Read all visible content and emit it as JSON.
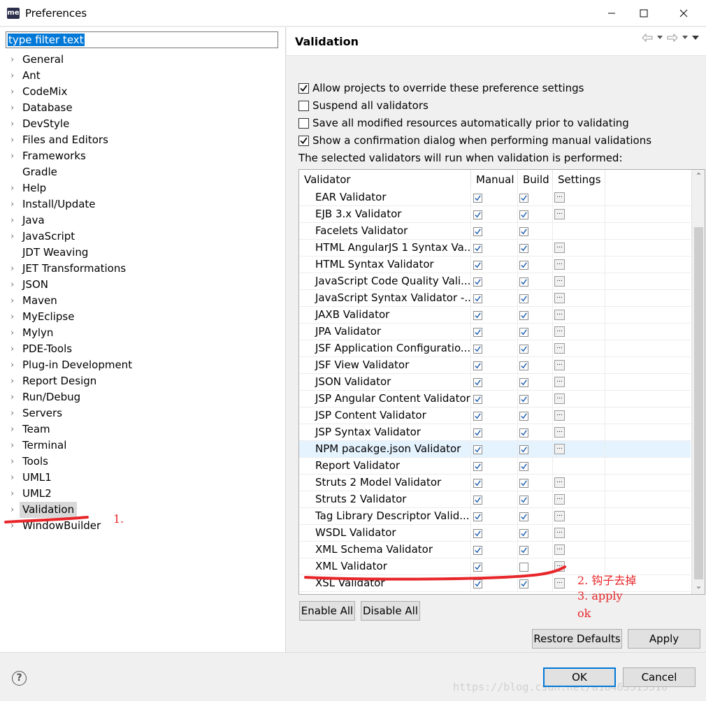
{
  "window": {
    "title": "Preferences",
    "icon_text": "me"
  },
  "filter": {
    "value": "type filter text"
  },
  "tree": [
    {
      "label": "General",
      "expandable": true
    },
    {
      "label": "Ant",
      "expandable": true
    },
    {
      "label": "CodeMix",
      "expandable": true
    },
    {
      "label": "Database",
      "expandable": true
    },
    {
      "label": "DevStyle",
      "expandable": true
    },
    {
      "label": "Files and Editors",
      "expandable": true
    },
    {
      "label": "Frameworks",
      "expandable": true
    },
    {
      "label": "Gradle",
      "expandable": false
    },
    {
      "label": "Help",
      "expandable": true
    },
    {
      "label": "Install/Update",
      "expandable": true
    },
    {
      "label": "Java",
      "expandable": true
    },
    {
      "label": "JavaScript",
      "expandable": true
    },
    {
      "label": "JDT Weaving",
      "expandable": false
    },
    {
      "label": "JET Transformations",
      "expandable": true
    },
    {
      "label": "JSON",
      "expandable": true
    },
    {
      "label": "Maven",
      "expandable": true
    },
    {
      "label": "MyEclipse",
      "expandable": true
    },
    {
      "label": "Mylyn",
      "expandable": true
    },
    {
      "label": "PDE-Tools",
      "expandable": true
    },
    {
      "label": "Plug-in Development",
      "expandable": true
    },
    {
      "label": "Report Design",
      "expandable": true
    },
    {
      "label": "Run/Debug",
      "expandable": true
    },
    {
      "label": "Servers",
      "expandable": true
    },
    {
      "label": "Team",
      "expandable": true
    },
    {
      "label": "Terminal",
      "expandable": true
    },
    {
      "label": "Tools",
      "expandable": true
    },
    {
      "label": "UML1",
      "expandable": true
    },
    {
      "label": "UML2",
      "expandable": true
    },
    {
      "label": "Validation",
      "expandable": true,
      "selected": true
    },
    {
      "label": "WindowBuilder",
      "expandable": true
    }
  ],
  "page": {
    "title": "Validation",
    "options": [
      {
        "label": "Allow projects to override these preference settings",
        "checked": true
      },
      {
        "label": "Suspend all validators",
        "checked": false
      },
      {
        "label": "Save all modified resources automatically prior to validating",
        "checked": false
      },
      {
        "label": "Show a confirmation dialog when performing manual validations",
        "checked": true
      }
    ],
    "info": "The selected validators will run when validation is performed:"
  },
  "table": {
    "headers": [
      "Validator",
      "Manual",
      "Build",
      "Settings"
    ],
    "settings_button_label": "...",
    "rows": [
      {
        "name": "EAR Validator",
        "manual": true,
        "build": true,
        "settings": true
      },
      {
        "name": "EJB 3.x Validator",
        "manual": true,
        "build": true,
        "settings": true
      },
      {
        "name": "Facelets Validator",
        "manual": true,
        "build": true,
        "settings": false
      },
      {
        "name": "HTML AngularJS 1 Syntax Va...",
        "manual": true,
        "build": true,
        "settings": true
      },
      {
        "name": "HTML Syntax Validator",
        "manual": true,
        "build": true,
        "settings": true
      },
      {
        "name": "JavaScript Code Quality Vali...",
        "manual": true,
        "build": true,
        "settings": true
      },
      {
        "name": "JavaScript Syntax Validator -...",
        "manual": true,
        "build": true,
        "settings": true
      },
      {
        "name": "JAXB Validator",
        "manual": true,
        "build": true,
        "settings": true
      },
      {
        "name": "JPA Validator",
        "manual": true,
        "build": true,
        "settings": true
      },
      {
        "name": "JSF Application Configuratio...",
        "manual": true,
        "build": true,
        "settings": true
      },
      {
        "name": "JSF View Validator",
        "manual": true,
        "build": true,
        "settings": true
      },
      {
        "name": "JSON Validator",
        "manual": true,
        "build": true,
        "settings": true
      },
      {
        "name": "JSP Angular Content Validator",
        "manual": true,
        "build": true,
        "settings": true
      },
      {
        "name": "JSP Content Validator",
        "manual": true,
        "build": true,
        "settings": true
      },
      {
        "name": "JSP Syntax Validator",
        "manual": true,
        "build": true,
        "settings": true
      },
      {
        "name": "NPM pacakge.json Validator",
        "manual": true,
        "build": true,
        "settings": true,
        "highlighted": true
      },
      {
        "name": "Report Validator",
        "manual": true,
        "build": true,
        "settings": false
      },
      {
        "name": "Struts 2 Model Validator",
        "manual": true,
        "build": true,
        "settings": true
      },
      {
        "name": "Struts 2 Validator",
        "manual": true,
        "build": true,
        "settings": true
      },
      {
        "name": "Tag Library Descriptor Valid...",
        "manual": true,
        "build": true,
        "settings": true
      },
      {
        "name": "WSDL Validator",
        "manual": true,
        "build": true,
        "settings": true
      },
      {
        "name": "XML Schema Validator",
        "manual": true,
        "build": true,
        "settings": true
      },
      {
        "name": "XML Validator",
        "manual": true,
        "build": false,
        "settings": true
      },
      {
        "name": "XSL Validator",
        "manual": true,
        "build": true,
        "settings": true
      }
    ]
  },
  "buttons": {
    "enable_all": "Enable All",
    "disable_all": "Disable All",
    "restore_defaults": "Restore Defaults",
    "apply": "Apply",
    "ok": "OK",
    "cancel": "Cancel"
  },
  "footer": {
    "help_icon": "?",
    "watermark": "https://blog.csdn.net/a18465515510"
  },
  "annotations": {
    "step1": "1.",
    "step2": "2. 钩子去掉",
    "step3": "3. apply",
    "step3b": "ok",
    "color": "#e8262a"
  },
  "colors": {
    "selection": "#0078d7",
    "row_highlight": "#e5f3ff",
    "check": "#1f5fae"
  }
}
